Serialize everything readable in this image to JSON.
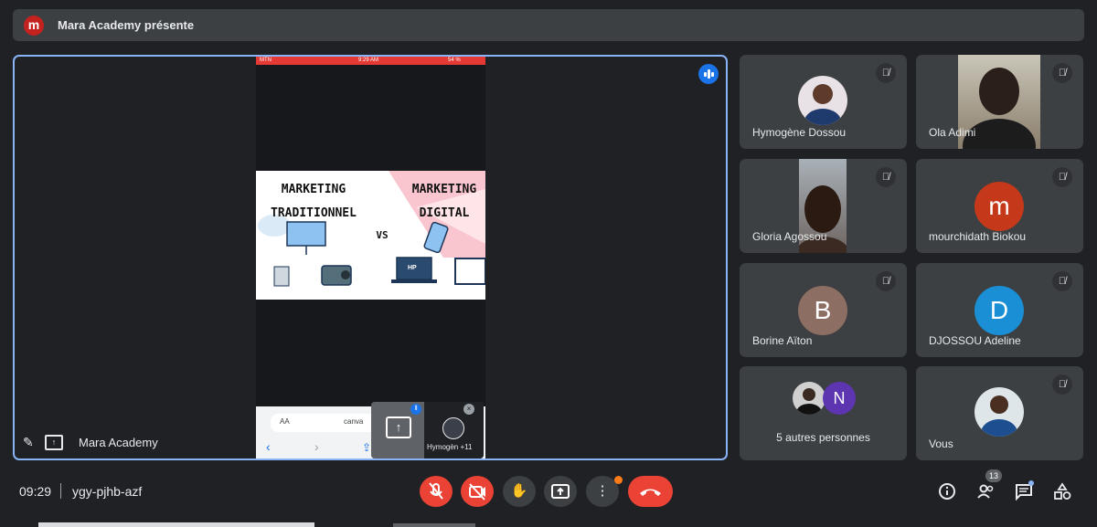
{
  "header": {
    "logo_letter": "m",
    "title": "Mara Academy présente"
  },
  "main_stage": {
    "presenter_name": "Mara Academy",
    "phone": {
      "status_left": "MTN",
      "status_time": "9:29 AM",
      "status_right": "54 %",
      "slide": {
        "left_title_1": "MARKETING",
        "left_title_2": "TRADITIONNEL",
        "vs": "VS",
        "right_title_1": "MARKETING",
        "right_title_2": "DIGITAL",
        "laptop_label": "HP"
      },
      "browser": {
        "text_size": "AA",
        "url": "canva"
      }
    },
    "self_pip": {
      "name": "Hymogèn +11"
    }
  },
  "participants": [
    {
      "name": "Hymogène Dossou",
      "type": "photo",
      "muted": true
    },
    {
      "name": "Ola Adimi",
      "type": "camera",
      "muted": true
    },
    {
      "name": "Gloria Agossou",
      "type": "camera",
      "muted": true
    },
    {
      "name": "mourchidath Biokou",
      "type": "letter",
      "letter": "m",
      "color": "#c5391a",
      "muted": true
    },
    {
      "name": "Borine Aïton",
      "type": "letter",
      "letter": "B",
      "color": "#8d6e63",
      "muted": true
    },
    {
      "name": "DJOSSOU Adeline",
      "type": "letter",
      "letter": "D",
      "color": "#1a8fd6",
      "muted": true
    },
    {
      "name": "5 autres personnes",
      "type": "group",
      "letter": "N",
      "color": "#5e35b1"
    },
    {
      "name": "Vous",
      "type": "photo",
      "muted": true
    }
  ],
  "bottom_bar": {
    "time": "09:29",
    "meeting_code": "ygy-pjhb-azf",
    "participant_count": "13",
    "controls": [
      "mic-off",
      "camera-off",
      "raise-hand",
      "present",
      "more",
      "leave"
    ],
    "right_icons": [
      "info",
      "people",
      "chat",
      "activities"
    ]
  }
}
